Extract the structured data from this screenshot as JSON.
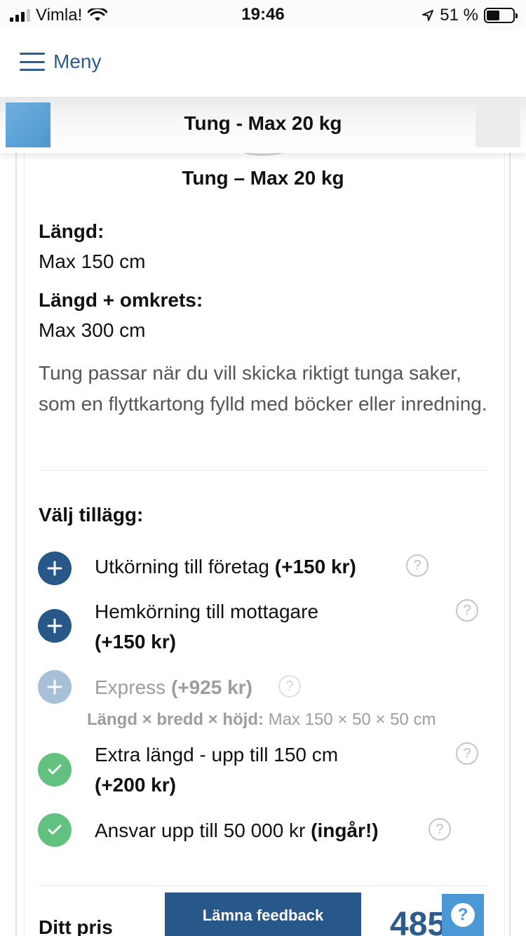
{
  "status_bar": {
    "carrier": "Vimla!",
    "time": "19:46",
    "battery": "51 %",
    "battery_level": 0.51
  },
  "header": {
    "menu_label": "Meny"
  },
  "sticky_bar": {
    "title": "Tung - Max 20 kg"
  },
  "product": {
    "title": "Tung – Max 20 kg",
    "length_label": "Längd:",
    "length_value": "Max 150 cm",
    "length_girth_label": "Längd + omkrets:",
    "length_girth_value": "Max 300 cm",
    "description": "Tung passar när du vill skicka riktigt tunga saker, som en flyttkartong fylld med böcker eller inredning."
  },
  "addons": {
    "heading": "Välj tillägg:",
    "items": [
      {
        "text": "Utkörning till företag",
        "price": "(+150 kr)",
        "state": "add"
      },
      {
        "text": "Hemkörning till mottagare",
        "price": "(+150 kr)",
        "state": "add"
      },
      {
        "text": "Express",
        "price": "(+925 kr)",
        "state": "disabled"
      },
      {
        "text": "Extra längd - upp till 150 cm",
        "price": "(+200 kr)",
        "state": "selected"
      },
      {
        "text": "Ansvar upp till 50 000 kr",
        "price": "(ingår!)",
        "state": "selected"
      }
    ],
    "express_dims_label": "Längd × bredd × höjd:",
    "express_dims_value": "Max 150 × 50 × 50 cm"
  },
  "price": {
    "label": "Ditt pris",
    "value": "485"
  },
  "feedback_label": "Lämna feedback",
  "help_symbol": "?",
  "icons": {
    "add": "plus-icon",
    "selected": "check-icon",
    "help": "question-circle-icon",
    "menu": "hamburger-icon"
  },
  "colors": {
    "primary": "#28578a",
    "primary_disabled": "#a7c0d8",
    "selected": "#62c17e",
    "link": "#2c5b8c",
    "help_fab": "#4a99d6"
  }
}
